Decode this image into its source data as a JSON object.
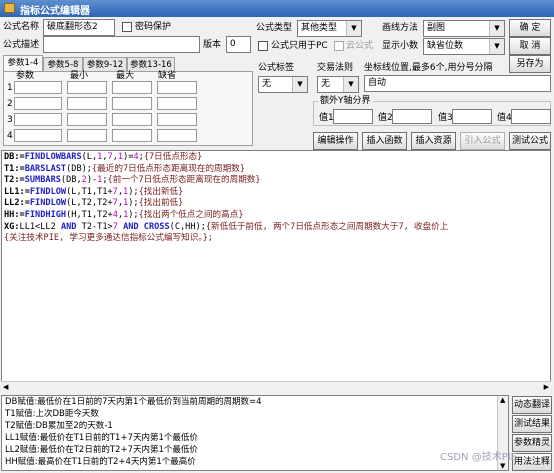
{
  "window": {
    "title": "指标公式编辑器"
  },
  "form": {
    "name_label": "公式名称",
    "name_value": "破底翻形态2",
    "password_label": "密码保护",
    "desc_label": "公式描述",
    "desc_value": "",
    "version_label": "版本",
    "version_value": "0",
    "type_label": "公式类型",
    "type_value": "其他类型",
    "draw_label": "画线方法",
    "draw_value": "副图",
    "pc_only_label": "公式只用于PC",
    "cloud_label": "云公式",
    "decimals_label": "显示小数",
    "decimals_value": "缺省位数",
    "tag_label": "公式标签",
    "tag_value": "无",
    "trade_label": "交易法则",
    "trade_value": "无",
    "axis_pos_label": "坐标线位置,最多6个,用分号分隔",
    "axis_pos_value": "自动",
    "extra_axis_label": "额外Y轴分界",
    "val1": "值1",
    "val2": "值2",
    "val3": "值3",
    "val4": "值4"
  },
  "buttons": {
    "ok": "确 定",
    "cancel": "取 消",
    "save_as": "另存为",
    "edit_op": "编辑操作",
    "insert_func": "插入函数",
    "insert_res": "插入资源",
    "import_formula": "引入公式",
    "test_formula": "测试公式",
    "dyn_translate": "动态翻译",
    "test_result": "测试结果",
    "param_tips": "参数精灵",
    "usage_notes": "用法注释"
  },
  "tabs": [
    "参数1-4",
    "参数5-8",
    "参数9-12",
    "参数13-16"
  ],
  "param_table": {
    "headers": [
      "参数",
      "最小",
      "最大",
      "缺省"
    ],
    "rows": [
      "1",
      "2",
      "3",
      "4"
    ]
  },
  "code": {
    "l1_name": "DB:=",
    "l1_fn": "FINDLOWBARS",
    "l1_args_a": "(L,",
    "l1_n1": "1",
    "l1_c1": ",",
    "l1_n2": "7",
    "l1_c2": ",",
    "l1_n3": "1",
    "l1_args_b": ")=",
    "l1_n4": "4",
    "l1_sc": ";",
    "l1_cm": "{7日低点形态}",
    "l2_name": "T1:=",
    "l2_fn": "BARSLAST",
    "l2_args": "(DB);",
    "l2_cm": "{最近的7日低点形态距离现在的周期数}",
    "l3_name": "T2:=",
    "l3_fn": "SUMBARS",
    "l3_args_a": "(DB,",
    "l3_n1": "2",
    "l3_args_b": ")-",
    "l3_n2": "1",
    "l3_sc": ";",
    "l3_cm": "{前一个7日低点形态距离现在的周期数}",
    "l4_name": "LL1:=",
    "l4_fn": "FINDLOW",
    "l4_args_a": "(L,T1,T1+",
    "l4_n1": "7",
    "l4_c1": ",",
    "l4_n2": "1",
    "l4_sc": ");",
    "l4_cm": "{找出新低}",
    "l5_name": "LL2:=",
    "l5_fn": "FINDLOW",
    "l5_args_a": "(L,T2,T2+",
    "l5_n1": "7",
    "l5_c1": ",",
    "l5_n2": "1",
    "l5_sc": ");",
    "l5_cm": "{找出前低}",
    "l6_name": "HH:=",
    "l6_fn": "FINDHIGH",
    "l6_args_a": "(H,T1,T2+",
    "l6_n1": "4",
    "l6_c1": ",",
    "l6_n2": "1",
    "l6_sc": ");",
    "l6_cm": "{找出两个低点之间的高点}",
    "l7_name": "XG:",
    "l7_a": "LL1<LL2 ",
    "l7_and1": "AND",
    "l7_b": " T2-T1>",
    "l7_n1": "7",
    "l7_sp": " ",
    "l7_and2": "AND",
    "l7_sp2": " ",
    "l7_fn": "CROSS",
    "l7_args": "(C,HH);",
    "l7_cm": "{新低低于前低, 两个7日低点形态之间周期数大于7, 收盘价上",
    "l8_cm": "{关注技术PIE, 学习更多通达信指标公式编写知识。};"
  },
  "translation_lines": [
    "DB赋值:最低价在1日前的7天内第1个最低价到当前周期的周期数=4",
    "T1赋值:上次DB距今天数",
    "T2赋值:DB累加至2的天数-1",
    "LL1赋值:最低价在T1日前的T1+7天内第1个最低价",
    "LL2赋值:最低价在T2日前的T2+7天内第1个最低价",
    "HH赋值:最高价在T1日前的T2+4天内第1个最高价"
  ],
  "watermark": "CSDN @技术PIE"
}
